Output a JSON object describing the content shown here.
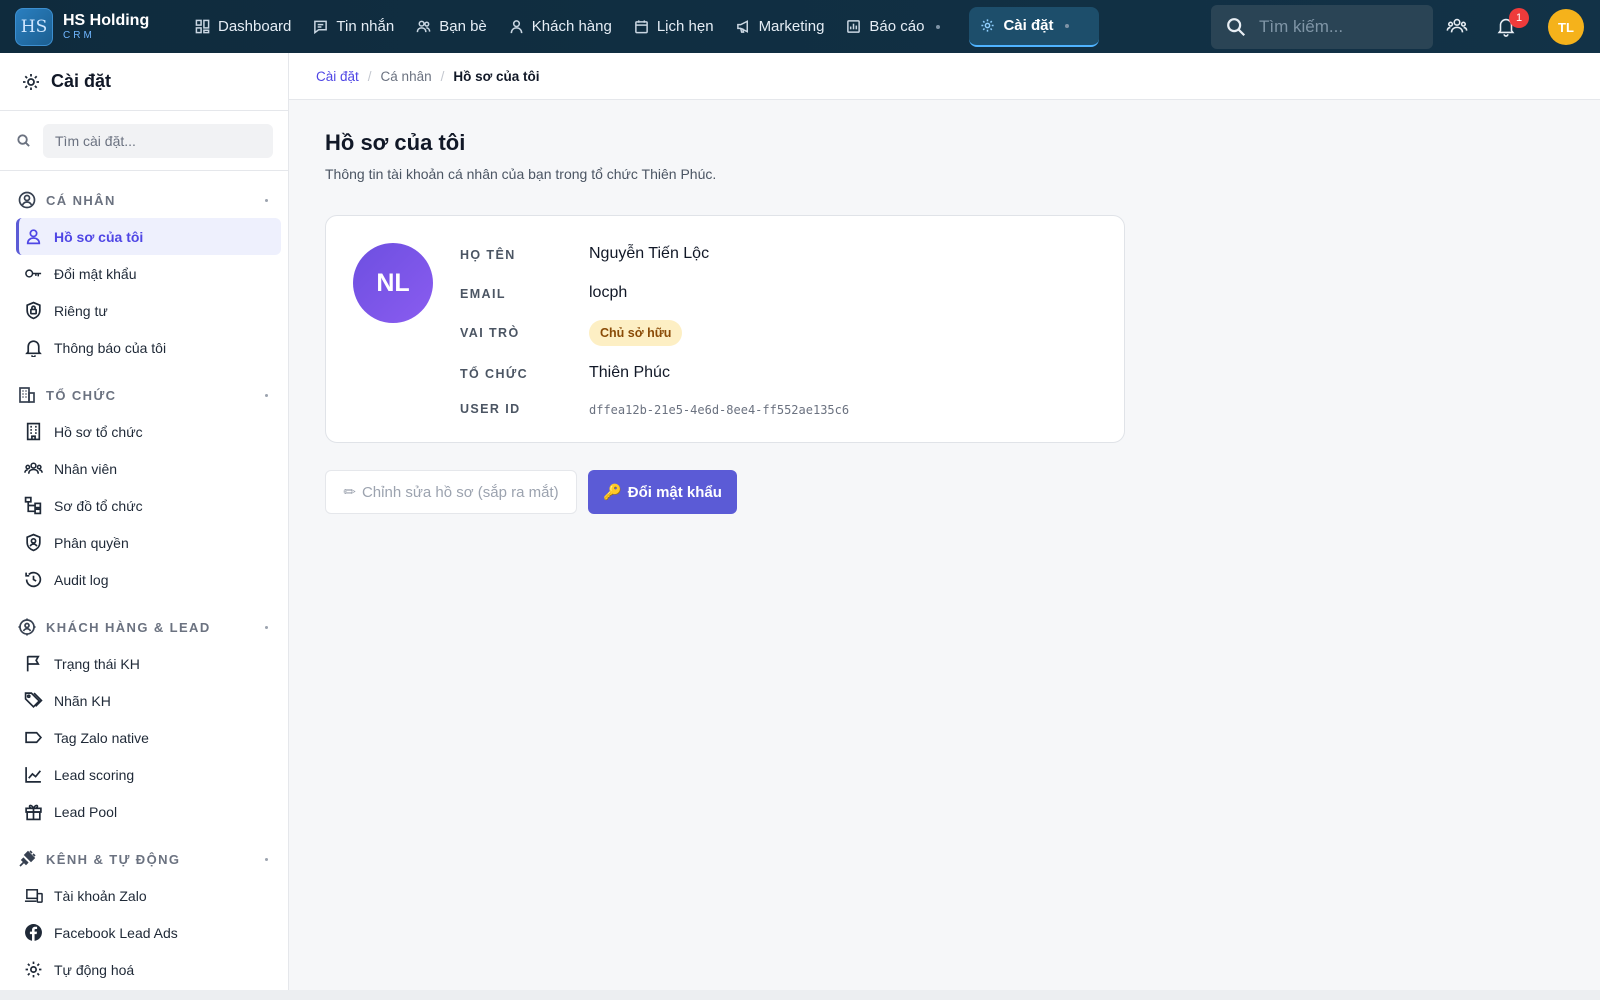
{
  "brand": {
    "logo_text": "HS",
    "name": "HS Holding",
    "sub": "CRM"
  },
  "nav": {
    "items": [
      {
        "label": "Dashboard",
        "icon": "grid-icon"
      },
      {
        "label": "Tin nhắn",
        "icon": "message-icon"
      },
      {
        "label": "Bạn bè",
        "icon": "friends-icon"
      },
      {
        "label": "Khách hàng",
        "icon": "customer-icon"
      },
      {
        "label": "Lịch hẹn",
        "icon": "calendar-icon"
      },
      {
        "label": "Marketing",
        "icon": "megaphone-icon"
      },
      {
        "label": "Báo cáo",
        "icon": "report-icon"
      },
      {
        "label": "Cài đặt",
        "icon": "gear-icon",
        "active": true
      }
    ],
    "search_placeholder": "Tìm kiếm...",
    "notification_count": "1",
    "user_initials": "TL"
  },
  "sidebar": {
    "title": "Cài đặt",
    "search_placeholder": "Tìm cài đặt...",
    "sections": [
      {
        "label": "CÁ NHÂN",
        "items": [
          "Hồ sơ của tôi",
          "Đổi mật khẩu",
          "Riêng tư",
          "Thông báo của tôi"
        ]
      },
      {
        "label": "TỔ CHỨC",
        "items": [
          "Hồ sơ tổ chức",
          "Nhân viên",
          "Sơ đồ tổ chức",
          "Phân quyền",
          "Audit log"
        ]
      },
      {
        "label": "KHÁCH HÀNG & LEAD",
        "items": [
          "Trạng thái KH",
          "Nhãn KH",
          "Tag Zalo native",
          "Lead scoring",
          "Lead Pool"
        ]
      },
      {
        "label": "KÊNH & TỰ ĐỘNG",
        "items": [
          "Tài khoản Zalo",
          "Facebook Lead Ads",
          "Tự động hoá"
        ]
      }
    ]
  },
  "breadcrumb": {
    "root": "Cài đặt",
    "mid": "Cá nhân",
    "current": "Hồ sơ của tôi"
  },
  "page": {
    "title": "Hồ sơ của tôi",
    "subtitle": "Thông tin tài khoản cá nhân của bạn trong tổ chức Thiên Phúc."
  },
  "profile": {
    "avatar_initials": "NL",
    "name_label": "HỌ TÊN",
    "name": "Nguyễn Tiến Lộc",
    "email_label": "EMAIL",
    "email": "locph",
    "role_label": "VAI TRÒ",
    "role": "Chủ sở hữu",
    "org_label": "TỔ CHỨC",
    "org": "Thiên Phúc",
    "userid_label": "USER ID",
    "user_id": "dffea12b-21e5-4e6d-8ee4-ff552ae135c6"
  },
  "actions": {
    "edit_icon": "✏",
    "edit_label": "Chỉnh sửa hồ sơ (sắp ra mắt)",
    "change_pw_icon": "🔑",
    "change_pw_label": "Đổi mật khẩu"
  }
}
